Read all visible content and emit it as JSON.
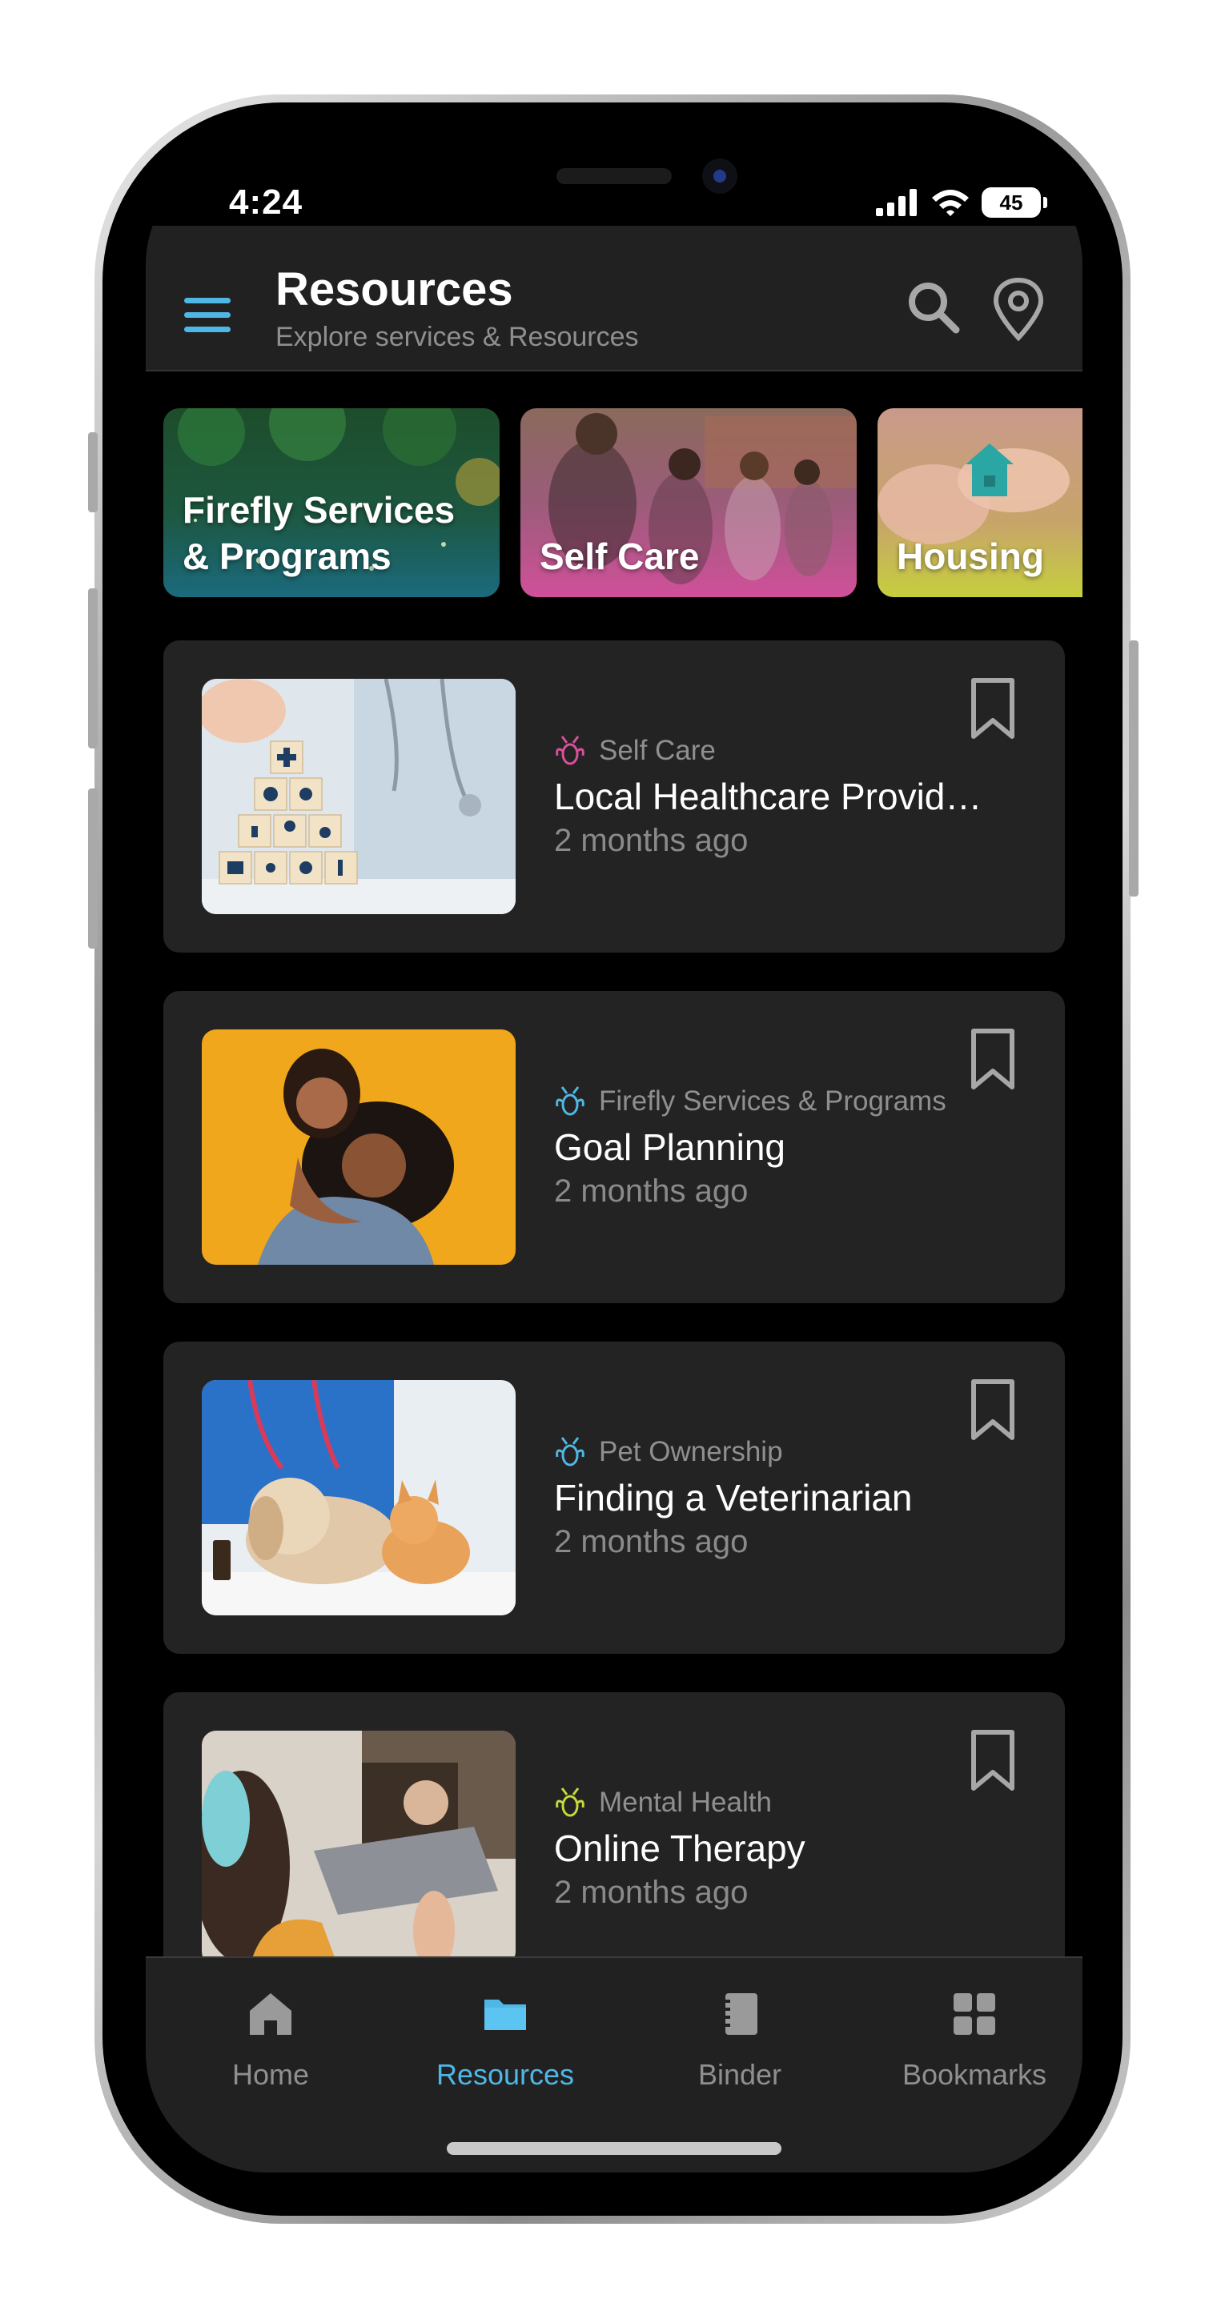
{
  "status_bar": {
    "time": "4:24",
    "battery": "45"
  },
  "header": {
    "title": "Resources",
    "subtitle": "Explore services & Resources"
  },
  "categories": [
    {
      "label": "Firefly Services\n& Programs"
    },
    {
      "label": "Self Care"
    },
    {
      "label": "Housing"
    }
  ],
  "resources": [
    {
      "category": "Self Care",
      "category_color": "#d9519a",
      "title": "Local Healthcare Provid…",
      "time": "2 months ago"
    },
    {
      "category": "Firefly Services & Programs",
      "category_color": "#4fb7e6",
      "title": "Goal Planning",
      "time": "2 months ago"
    },
    {
      "category": "Pet Ownership",
      "category_color": "#4fb7e6",
      "title": "Finding a Veterinarian",
      "time": "2 months ago"
    },
    {
      "category": "Mental Health",
      "category_color": "#c6d93a",
      "title": "Online Therapy",
      "time": "2 months ago"
    }
  ],
  "bottom_nav": {
    "items": [
      {
        "label": "Home",
        "icon": "home-icon",
        "active": false
      },
      {
        "label": "Resources",
        "icon": "folder-icon",
        "active": true
      },
      {
        "label": "Binder",
        "icon": "binder-icon",
        "active": false
      },
      {
        "label": "Bookmarks",
        "icon": "grid-icon",
        "active": false
      }
    ]
  },
  "colors": {
    "accent": "#4fb7e6",
    "surface": "#232323",
    "header": "#212121"
  }
}
